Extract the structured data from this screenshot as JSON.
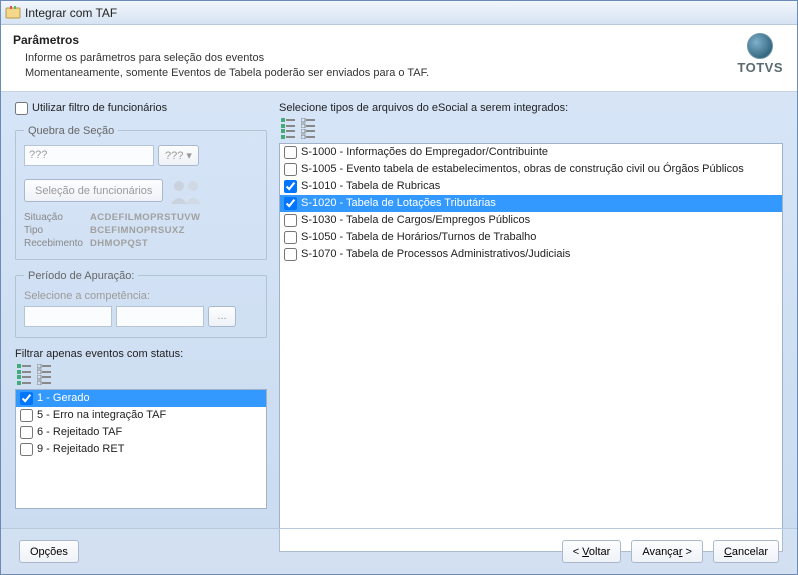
{
  "window": {
    "title": "Integrar com TAF"
  },
  "header": {
    "heading": "Parâmetros",
    "line1": "Informe os parâmetros para seleção dos eventos",
    "line2": "Momentaneamente, somente Eventos de Tabela poderão ser enviados para o TAF.",
    "logo_text": "TOTVS"
  },
  "left": {
    "use_filter_label": "Utilizar filtro de funcionários",
    "use_filter_checked": false,
    "section_break": {
      "legend": "Quebra de Seção",
      "value": "???",
      "picker_label": "???"
    },
    "select_employees_btn": "Seleção de funcionários",
    "kv": {
      "situacao_k": "Situação",
      "situacao_v": "ACDEFILMOPRSTUVW",
      "tipo_k": "Tipo",
      "tipo_v": "BCEFIMNOPRSUXZ",
      "receb_k": "Recebimento",
      "receb_v": "DHMOPQST"
    },
    "period": {
      "legend": "Período de Apuração:",
      "hint": "Selecione a competência:",
      "from": "",
      "to": "",
      "picker": "..."
    },
    "status_filter": {
      "label": "Filtrar apenas eventos com status:",
      "items": [
        {
          "label": "1 - Gerado",
          "checked": true,
          "selected": true
        },
        {
          "label": "5 - Erro na integração TAF",
          "checked": false,
          "selected": false
        },
        {
          "label": "6 - Rejeitado TAF",
          "checked": false,
          "selected": false
        },
        {
          "label": "9 - Rejeitado RET",
          "checked": false,
          "selected": false
        }
      ]
    }
  },
  "right": {
    "label": "Selecione tipos de arquivos do eSocial a serem integrados:",
    "items": [
      {
        "label": "S-1000 - Informações do Empregador/Contribuinte",
        "checked": false,
        "selected": false
      },
      {
        "label": "S-1005 - Evento tabela de estabelecimentos, obras de construção civil ou Órgãos Públicos",
        "checked": false,
        "selected": false
      },
      {
        "label": "S-1010 - Tabela de Rubricas",
        "checked": true,
        "selected": false
      },
      {
        "label": "S-1020 - Tabela de Lotações Tributárias",
        "checked": true,
        "selected": true
      },
      {
        "label": "S-1030 - Tabela de Cargos/Empregos Públicos",
        "checked": false,
        "selected": false
      },
      {
        "label": "S-1050 - Tabela de Horários/Turnos de Trabalho",
        "checked": false,
        "selected": false
      },
      {
        "label": "S-1070 - Tabela de Processos Administrativos/Judiciais",
        "checked": false,
        "selected": false
      }
    ]
  },
  "footer": {
    "options": "Opções",
    "back_pre": "< ",
    "back_u": "V",
    "back_post": "oltar",
    "next_pre": "Avança",
    "next_u": "r",
    "next_post": " >",
    "cancel_u": "C",
    "cancel_post": "ancelar"
  }
}
